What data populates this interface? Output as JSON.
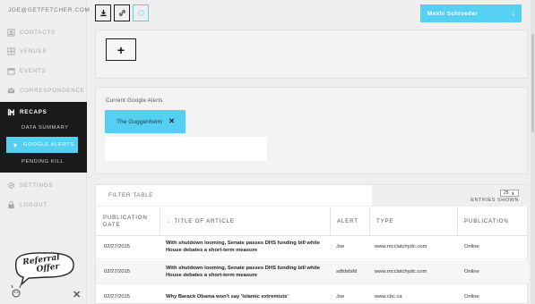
{
  "user": {
    "email": "JOE@GETFETCHER.COM"
  },
  "nav": {
    "contacts": "CONTACTS",
    "venues": "VENUES",
    "events": "EVENTS",
    "correspondence": "CORRESPONDENCE",
    "recaps": "RECAPS",
    "settings": "SETTINGS",
    "logout": "LOGOUT"
  },
  "recaps_sub": {
    "data_summary": "DATA SUMMARY",
    "google_alerts": "GOOGLE ALERTS",
    "pending_kill": "PENDING KILL"
  },
  "referral": {
    "text_line1": "Referral",
    "text_line2": "Offer"
  },
  "topbar": {
    "user_name": "Mekhi Schroeder"
  },
  "alerts": {
    "title": "Current Google Alerts",
    "chips": [
      "The Guggenheim"
    ],
    "input_value": ""
  },
  "table": {
    "filter_placeholder": "FILTER TABLE",
    "entries_value": "25",
    "entries_label": "ENTRIES SHOWN",
    "headers": [
      "PUBLICATION DATE",
      "TITLE OF ARTICLE",
      "ALERT",
      "TYPE",
      "PUBLICATION"
    ],
    "rows": [
      {
        "date": "02/27/2015",
        "title": "With shutdown looming, Senate passes DHS funding bill while House debates a short-term measure",
        "alert": "Joe",
        "type": "www.mcclatchydc.com",
        "publication": "Online"
      },
      {
        "date": "02/27/2015",
        "title": "With shutdown looming, Senate passes DHS funding bill while House debates a short-term measure",
        "alert": "sdfdsfsfd",
        "type": "www.mcclatchydc.com",
        "publication": "Online"
      },
      {
        "date": "02/27/2015",
        "title": "Why Barack Obama won't say 'Islamic extremists'",
        "alert": "Joe",
        "type": "www.cbc.ca",
        "publication": "Online"
      }
    ]
  },
  "colors": {
    "accent": "#55cff2",
    "dark": "#1a1a1a",
    "background": "#efefef"
  },
  "icons": {
    "contacts": "contacts-icon",
    "venues": "venues-icon",
    "events": "calendar-icon",
    "correspondence": "envelope-icon",
    "recaps": "recaps-icon",
    "settings": "gear-icon",
    "logout": "logout-icon",
    "google_alerts": "alert-icon"
  }
}
